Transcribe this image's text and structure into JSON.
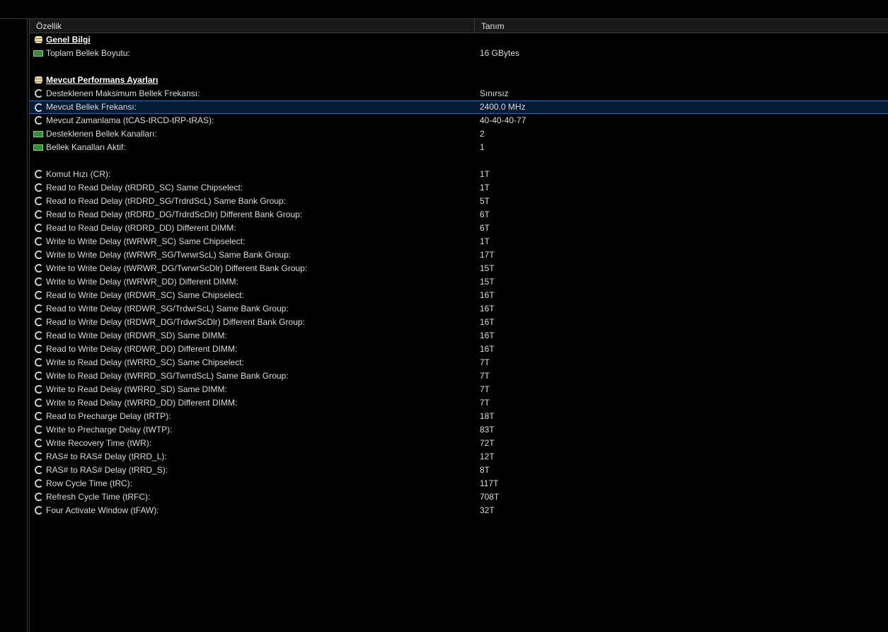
{
  "header": {
    "col_property": "Özellik",
    "col_value": "Tanım"
  },
  "rows": [
    {
      "type": "group",
      "icon": "database-icon",
      "label": "Genel Bilgi",
      "value": ""
    },
    {
      "type": "item",
      "icon": "memory-icon",
      "label": "Toplam Bellek Boyutu:",
      "value": "16 GBytes"
    },
    {
      "type": "blank",
      "label": "",
      "value": ""
    },
    {
      "type": "group",
      "icon": "database-icon",
      "label": "Mevcut Performans Ayarları",
      "value": ""
    },
    {
      "type": "item",
      "icon": "clock-icon",
      "label": "Desteklenen Maksimum Bellek Frekansı:",
      "value": "Sınırsız"
    },
    {
      "type": "item",
      "icon": "clock-icon",
      "label": "Mevcut Bellek Frekansı:",
      "value": "2400.0 MHz",
      "selected": true
    },
    {
      "type": "item",
      "icon": "clock-icon",
      "label": "Mevcut Zamanlama (tCAS-tRCD-tRP-tRAS):",
      "value": "40-40-40-77"
    },
    {
      "type": "item",
      "icon": "memory-icon",
      "label": "Desteklenen Bellek Kanalları:",
      "value": "2"
    },
    {
      "type": "item",
      "icon": "memory-icon",
      "label": "Bellek Kanalları Aktif:",
      "value": "1"
    },
    {
      "type": "blank",
      "label": "",
      "value": ""
    },
    {
      "type": "item",
      "icon": "clock-icon",
      "label": "Komut Hızı (CR):",
      "value": "1T"
    },
    {
      "type": "item",
      "icon": "clock-icon",
      "label": "Read to Read Delay (tRDRD_SC) Same Chipselect:",
      "value": "1T"
    },
    {
      "type": "item",
      "icon": "clock-icon",
      "label": "Read to Read Delay (tRDRD_SG/TrdrdScL) Same Bank Group:",
      "value": "5T"
    },
    {
      "type": "item",
      "icon": "clock-icon",
      "label": "Read to Read Delay (tRDRD_DG/TrdrdScDlr) Different Bank Group:",
      "value": "6T"
    },
    {
      "type": "item",
      "icon": "clock-icon",
      "label": "Read to Read Delay (tRDRD_DD) Different DIMM:",
      "value": "6T"
    },
    {
      "type": "item",
      "icon": "clock-icon",
      "label": "Write to Write Delay (tWRWR_SC) Same Chipselect:",
      "value": "1T"
    },
    {
      "type": "item",
      "icon": "clock-icon",
      "label": "Write to Write Delay (tWRWR_SG/TwrwrScL) Same Bank Group:",
      "value": "17T"
    },
    {
      "type": "item",
      "icon": "clock-icon",
      "label": "Write to Write Delay (tWRWR_DG/TwrwrScDlr) Different Bank Group:",
      "value": "15T"
    },
    {
      "type": "item",
      "icon": "clock-icon",
      "label": "Write to Write Delay (tWRWR_DD) Different DIMM:",
      "value": "15T"
    },
    {
      "type": "item",
      "icon": "clock-icon",
      "label": "Read to Write Delay (tRDWR_SC) Same Chipselect:",
      "value": "16T"
    },
    {
      "type": "item",
      "icon": "clock-icon",
      "label": "Read to Write Delay (tRDWR_SG/TrdwrScL) Same Bank Group:",
      "value": "16T"
    },
    {
      "type": "item",
      "icon": "clock-icon",
      "label": "Read to Write Delay (tRDWR_DG/TrdwrScDlr) Different Bank Group:",
      "value": "16T"
    },
    {
      "type": "item",
      "icon": "clock-icon",
      "label": "Read to Write Delay (tRDWR_SD) Same DIMM:",
      "value": "16T"
    },
    {
      "type": "item",
      "icon": "clock-icon",
      "label": "Read to Write Delay (tRDWR_DD) Different DIMM:",
      "value": "16T"
    },
    {
      "type": "item",
      "icon": "clock-icon",
      "label": "Write to Read Delay (tWRRD_SC) Same Chipselect:",
      "value": "7T"
    },
    {
      "type": "item",
      "icon": "clock-icon",
      "label": "Write to Read Delay (tWRRD_SG/TwrrdScL) Same Bank Group:",
      "value": "7T"
    },
    {
      "type": "item",
      "icon": "clock-icon",
      "label": "Write to Read Delay (tWRRD_SD) Same DIMM:",
      "value": "7T"
    },
    {
      "type": "item",
      "icon": "clock-icon",
      "label": "Write to Read Delay (tWRRD_DD) Different DIMM:",
      "value": "7T"
    },
    {
      "type": "item",
      "icon": "clock-icon",
      "label": "Read to Precharge Delay (tRTP):",
      "value": "18T"
    },
    {
      "type": "item",
      "icon": "clock-icon",
      "label": "Write to Precharge Delay (tWTP):",
      "value": "83T"
    },
    {
      "type": "item",
      "icon": "clock-icon",
      "label": "Write Recovery Time (tWR):",
      "value": "72T"
    },
    {
      "type": "item",
      "icon": "clock-icon",
      "label": "RAS# to RAS# Delay (tRRD_L):",
      "value": "12T"
    },
    {
      "type": "item",
      "icon": "clock-icon",
      "label": "RAS# to RAS# Delay (tRRD_S):",
      "value": "8T"
    },
    {
      "type": "item",
      "icon": "clock-icon",
      "label": "Row Cycle Time (tRC):",
      "value": "117T"
    },
    {
      "type": "item",
      "icon": "clock-icon",
      "label": "Refresh Cycle Time (tRFC):",
      "value": "708T"
    },
    {
      "type": "item",
      "icon": "clock-icon",
      "label": "Four Activate Window (tFAW):",
      "value": "32T"
    }
  ],
  "colors": {
    "selection_bg": "#051b33",
    "selection_border": "#2a6aa8",
    "header_bg": "#191919"
  }
}
